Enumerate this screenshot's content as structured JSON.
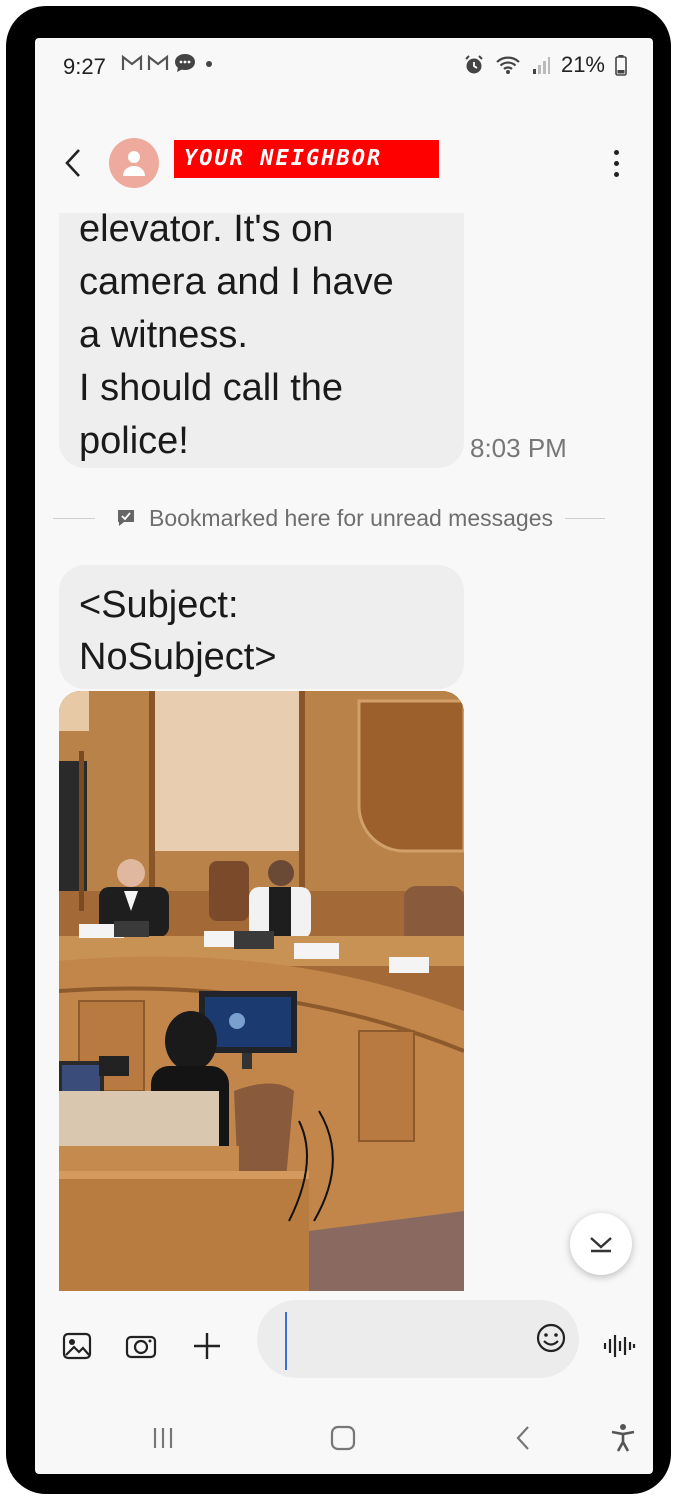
{
  "status_bar": {
    "time": "9:27",
    "battery_percent": "21%",
    "notification_icons": [
      "gmail-icon",
      "gmail-icon",
      "message-icon"
    ]
  },
  "header": {
    "contact_name": "YOUR NEIGHBOR",
    "avatar_color": "#eeaa9c",
    "name_highlight_color": "#ff0000"
  },
  "messages": [
    {
      "text": "elevator. It's on\ncamera and I have\na witness.\nI should call the\npolice!",
      "time": "8:03 PM"
    },
    {
      "subject": "<Subject:\nNoSubject>",
      "has_image": true
    }
  ],
  "bookmark": {
    "text": "Bookmarked here for unread messages"
  },
  "composer": {
    "placeholder": ""
  },
  "accent_color": "#3b6fd9"
}
